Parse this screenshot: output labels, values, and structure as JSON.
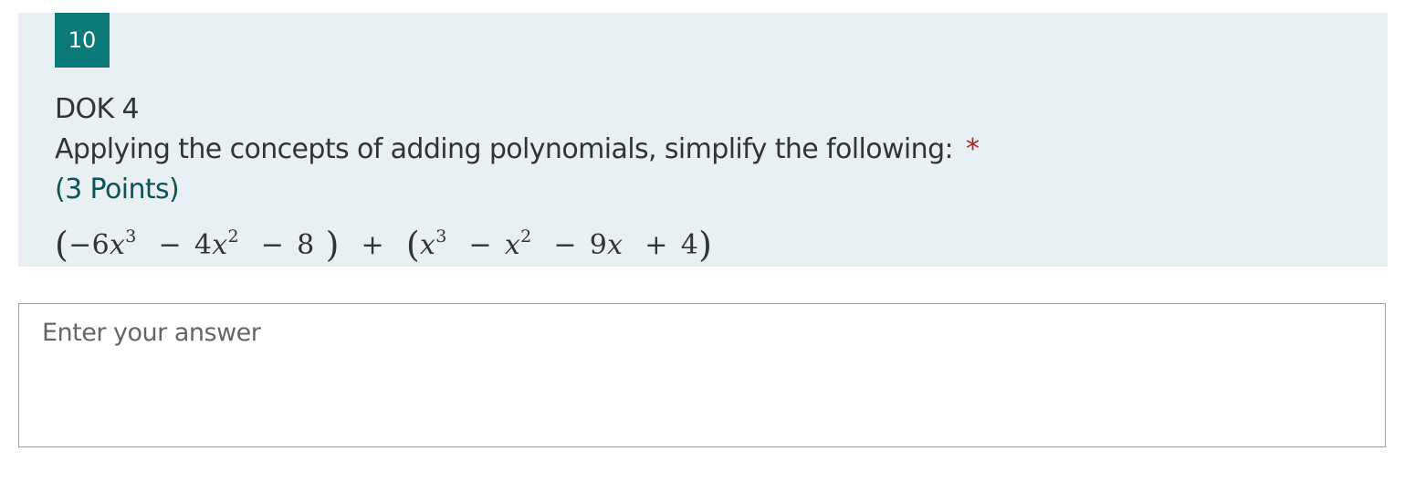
{
  "question": {
    "number": "10",
    "title_line1": "DOK 4",
    "title_line2": "Applying the concepts of adding polynomials, simplify the following:",
    "required_marker": "*",
    "points": "(3 Points)",
    "formula": {
      "open1": "(",
      "t1_coef": "−6",
      "t1_var": "x",
      "t1_exp": "3",
      "m1": "−",
      "t2_coef": "4",
      "t2_var": "x",
      "t2_exp": "2",
      "m2": "−",
      "t3": "8",
      "close1": ")",
      "plus": "+",
      "open2": "(",
      "u1_var": "x",
      "u1_exp": "3",
      "m3": "−",
      "u2_var": "x",
      "u2_exp": "2",
      "m4": "−",
      "u3_coef": "9",
      "u3_var": "x",
      "plus2": "+",
      "u4": "4",
      "close2": ")"
    }
  },
  "answer": {
    "placeholder": "Enter your answer",
    "value": ""
  },
  "colors": {
    "card_bg": "#e8f0f3",
    "number_badge": "#0b7a78",
    "required": "#a4262c",
    "points": "#0e5358"
  }
}
